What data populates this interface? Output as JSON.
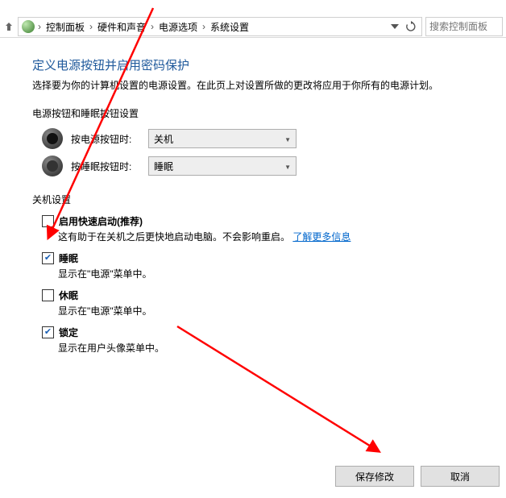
{
  "breadcrumb": {
    "items": [
      "控制面板",
      "硬件和声音",
      "电源选项",
      "系统设置"
    ],
    "search_placeholder": "搜索控制面板"
  },
  "page": {
    "title": "定义电源按钮并启用密码保护",
    "subtitle": "选择要为你的计算机设置的电源设置。在此页上对设置所做的更改将应用于你所有的电源计划。",
    "button_section_title": "电源按钮和睡眠按钮设置",
    "power_button_label": "按电源按钮时:",
    "power_button_value": "关机",
    "sleep_button_label": "按睡眠按钮时:",
    "sleep_button_value": "睡眠",
    "shutdown_section_title": "关机设置",
    "opt_fast": {
      "checked": false,
      "label": "启用快速启动(推荐)",
      "desc_pre": "这有助于在关机之后更快地启动电脑。不会影响重启。",
      "link": "了解更多信息"
    },
    "opt_sleep": {
      "checked": true,
      "label": "睡眠",
      "desc": "显示在\"电源\"菜单中。"
    },
    "opt_hiber": {
      "checked": false,
      "label": "休眠",
      "desc": "显示在\"电源\"菜单中。"
    },
    "opt_lock": {
      "checked": true,
      "label": "锁定",
      "desc": "显示在用户头像菜单中。"
    }
  },
  "buttons": {
    "save": "保存修改",
    "cancel": "取消"
  }
}
